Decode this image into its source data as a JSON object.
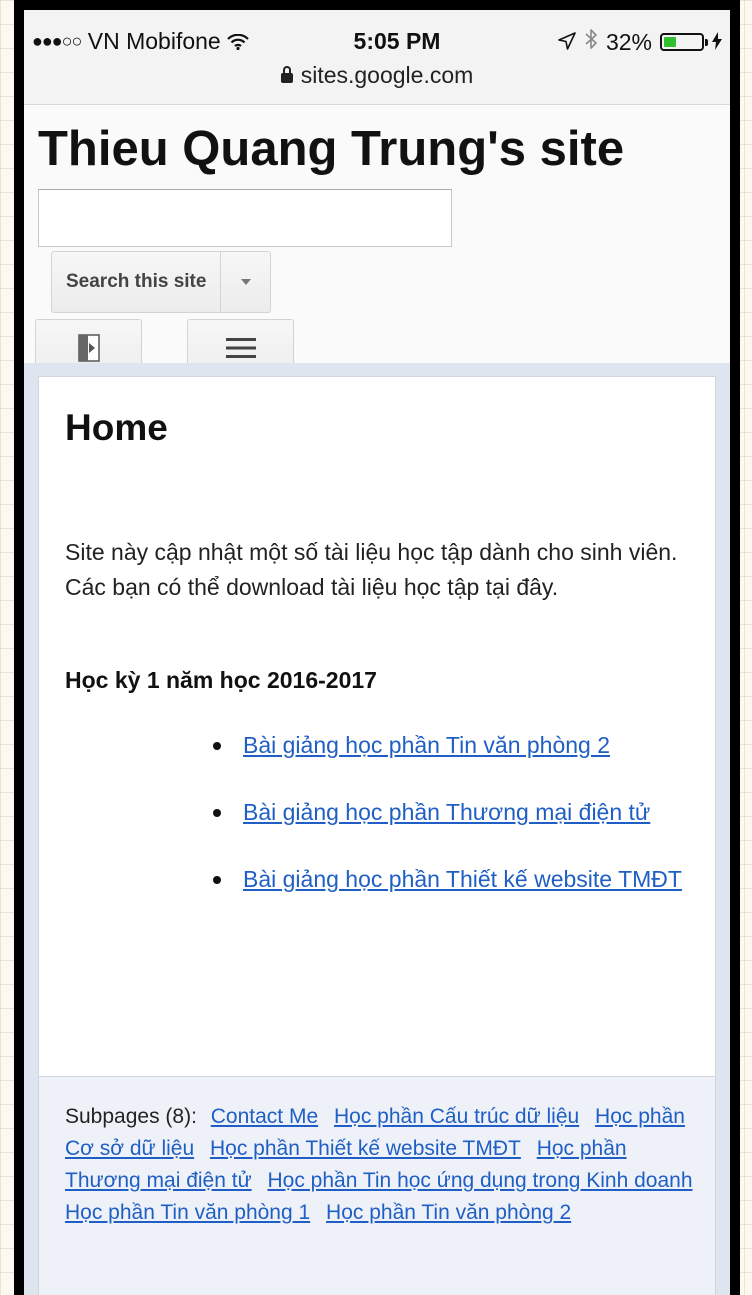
{
  "status_bar": {
    "carrier": "VN Mobifone",
    "time": "5:05 PM",
    "battery": "32%",
    "battery_level": 0.32
  },
  "address_bar": {
    "url": "sites.google.com"
  },
  "header": {
    "site_title": "Thieu Quang Trung's site",
    "search_value": "",
    "search_button_label": "Search this site"
  },
  "page": {
    "title": "Home",
    "intro": "Site này cập nhật một số tài liệu học tập dành cho sinh viên. Các bạn có thể download tài liệu học tập tại đây.",
    "semester_heading": "Học kỳ 1 năm học 2016-2017",
    "documents": [
      "Bài giảng học phần Tin văn phòng 2",
      "Bài giảng học phần Thương mại điện tử",
      "Bài giảng học phần Thiết kế website TMĐT"
    ]
  },
  "subpages": {
    "label": "Subpages (8):",
    "links": [
      "Contact Me",
      "Học phần Cấu trúc dữ liệu",
      "Học phần Cơ sở dữ liệu",
      "Học phần Thiết kế website TMĐT",
      "Học phần Thương mại điện tử",
      "Học phần Tin học ứng dụng trong Kinh doanh",
      "Học phần Tin văn phòng 1",
      "Học phần Tin văn phòng 2"
    ]
  },
  "colors": {
    "link": "#1f5fc5",
    "content_background": "#dfe5ee",
    "battery_fill": "#2fbf2f"
  }
}
